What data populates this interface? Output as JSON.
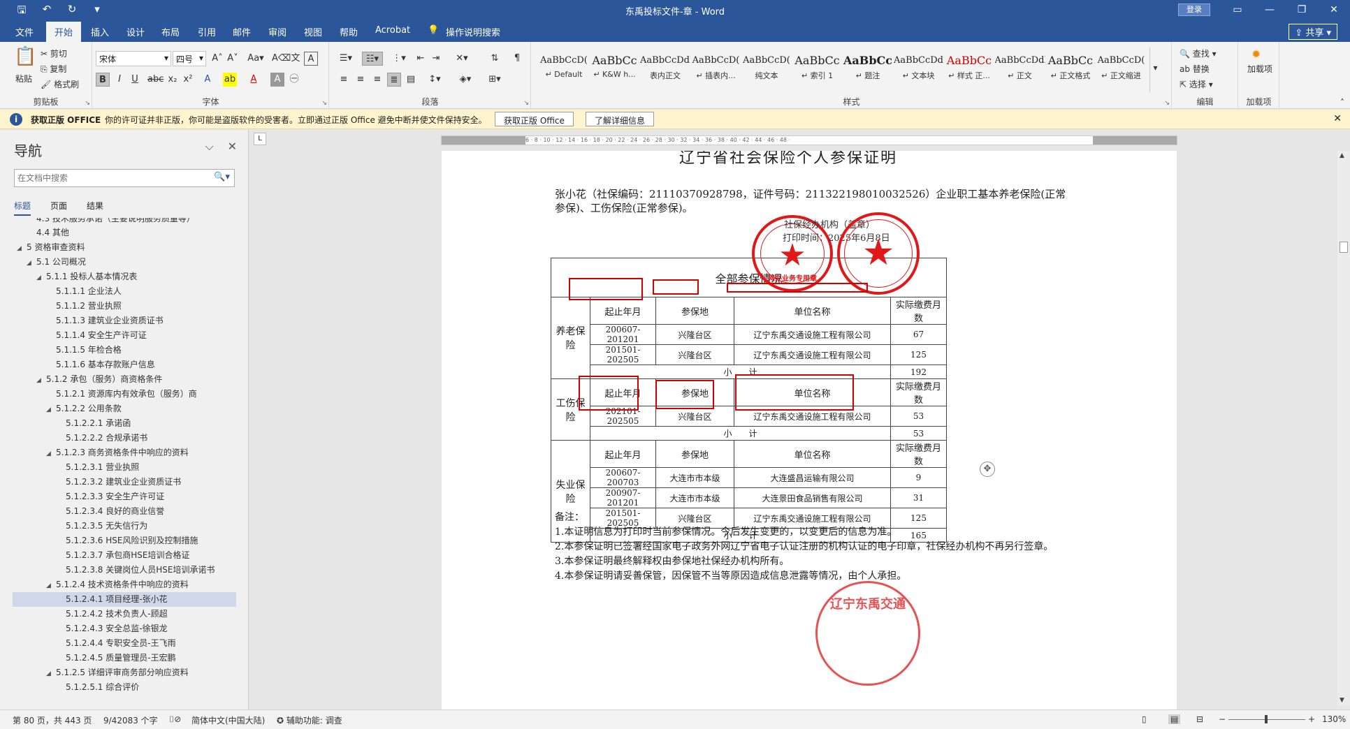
{
  "window": {
    "title": "东禹投标文件-章 - Word",
    "login_label": "登录",
    "share_label": "共享"
  },
  "tabs": [
    "文件",
    "开始",
    "插入",
    "设计",
    "布局",
    "引用",
    "邮件",
    "审阅",
    "视图",
    "帮助",
    "Acrobat",
    "操作说明搜索"
  ],
  "active_tab": "开始",
  "ribbon": {
    "clipboard": {
      "label": "剪贴板",
      "paste": "粘贴",
      "cut": "剪切",
      "copy": "复制",
      "format_painter": "格式刷"
    },
    "font": {
      "label": "字体",
      "font_name": "宋体",
      "font_size": "四号"
    },
    "paragraph": {
      "label": "段落"
    },
    "styles": {
      "label": "样式",
      "items": [
        {
          "sample": "AaBbCcD(",
          "name": "↵ Default"
        },
        {
          "sample": "AaBbCc",
          "name": "↵ K&W h..."
        },
        {
          "sample": "AaBbCcDdI",
          "name": "表内正文"
        },
        {
          "sample": "AaBbCcD(",
          "name": "↵ 插表内..."
        },
        {
          "sample": "AaBbCcD(",
          "name": "纯文本"
        },
        {
          "sample": "AaBbCc",
          "name": "↵ 索引 1"
        },
        {
          "sample": "AaBbCc",
          "name": "↵ 题注"
        },
        {
          "sample": "AaBbCcDd",
          "name": "↵ 文本块"
        },
        {
          "sample": "AaBbCc",
          "name": "↵ 样式 正..."
        },
        {
          "sample": "AaBbCcDdI",
          "name": "↵ 正文"
        },
        {
          "sample": "AaBbCc",
          "name": "↵ 正文格式"
        },
        {
          "sample": "AaBbCcD(",
          "name": "↵ 正文缩进"
        }
      ]
    },
    "editing": {
      "label": "编辑",
      "find": "查找",
      "replace": "替换",
      "select": "选择"
    },
    "addins": {
      "label": "加载项",
      "button": "加载项"
    }
  },
  "message_bar": {
    "title": "获取正版 OFFICE",
    "text": "你的许可证并非正版，你可能是盗版软件的受害者。立即通过正版 Office 避免中断并使文件保持安全。",
    "button1": "获取正版 Office",
    "button2": "了解详细信息"
  },
  "nav": {
    "title": "导航",
    "search_placeholder": "在文档中搜索",
    "tabs": [
      "标题",
      "页面",
      "结果"
    ],
    "items": [
      {
        "text": "4.3 技术服务承诺（主要说明服务质量等）",
        "level": 2,
        "tri": ""
      },
      {
        "text": "4.4 其他",
        "level": 2,
        "tri": ""
      },
      {
        "text": "5 资格审查资料",
        "level": 1,
        "tri": "◢"
      },
      {
        "text": "5.1 公司概况",
        "level": 2,
        "tri": "◢"
      },
      {
        "text": "5.1.1 投标人基本情况表",
        "level": 3,
        "tri": "◢"
      },
      {
        "text": "5.1.1.1 企业法人",
        "level": 4,
        "tri": ""
      },
      {
        "text": "5.1.1.2 营业执照",
        "level": 4,
        "tri": ""
      },
      {
        "text": "5.1.1.3 建筑业企业资质证书",
        "level": 4,
        "tri": ""
      },
      {
        "text": "5.1.1.4 安全生产许可证",
        "level": 4,
        "tri": ""
      },
      {
        "text": "5.1.1.5 年检合格",
        "level": 4,
        "tri": ""
      },
      {
        "text": "5.1.1.6 基本存款账户信息",
        "level": 4,
        "tri": ""
      },
      {
        "text": "5.1.2 承包（服务）商资格条件",
        "level": 3,
        "tri": "◢"
      },
      {
        "text": "5.1.2.1 资源库内有效承包（服务）商",
        "level": 4,
        "tri": ""
      },
      {
        "text": "5.1.2.2 公用条款",
        "level": 4,
        "tri": "◢"
      },
      {
        "text": "5.1.2.2.1 承诺函",
        "level": 5,
        "tri": ""
      },
      {
        "text": "5.1.2.2.2 合规承诺书",
        "level": 5,
        "tri": ""
      },
      {
        "text": "5.1.2.3 商务资格条件中响应的资料",
        "level": 4,
        "tri": "◢"
      },
      {
        "text": "5.1.2.3.1 营业执照",
        "level": 5,
        "tri": ""
      },
      {
        "text": "5.1.2.3.2 建筑业企业资质证书",
        "level": 5,
        "tri": ""
      },
      {
        "text": "5.1.2.3.3 安全生产许可证",
        "level": 5,
        "tri": ""
      },
      {
        "text": "5.1.2.3.4 良好的商业信誉",
        "level": 5,
        "tri": ""
      },
      {
        "text": "5.1.2.3.5 无失信行为",
        "level": 5,
        "tri": ""
      },
      {
        "text": "5.1.2.3.6 HSE风险识别及控制措施",
        "level": 5,
        "tri": ""
      },
      {
        "text": "5.1.2.3.7 承包商HSE培训合格证",
        "level": 5,
        "tri": ""
      },
      {
        "text": "5.1.2.3.8 关键岗位人员HSE培训承诺书",
        "level": 5,
        "tri": ""
      },
      {
        "text": "5.1.2.4 技术资格条件中响应的资料",
        "level": 4,
        "tri": "◢"
      },
      {
        "text": "5.1.2.4.1 项目经理-张小花",
        "level": 5,
        "tri": "",
        "selected": true
      },
      {
        "text": "5.1.2.4.2 技术负责人-顾超",
        "level": 5,
        "tri": ""
      },
      {
        "text": "5.1.2.4.3 安全总监-徐银龙",
        "level": 5,
        "tri": ""
      },
      {
        "text": "5.1.2.4.4 专职安全员-王飞雨",
        "level": 5,
        "tri": ""
      },
      {
        "text": "5.1.2.4.5 质量管理员-王宏鹏",
        "level": 5,
        "tri": ""
      },
      {
        "text": "5.1.2.5 详细评审商务部分响应资料",
        "level": 4,
        "tri": "◢"
      },
      {
        "text": "5.1.2.5.1 综合评价",
        "level": 5,
        "tri": ""
      }
    ]
  },
  "document": {
    "title": "辽宁省社会保险个人参保证明",
    "intro": "张小花（社保编码：21110370928798，证件号码：211322198010032526）企业职工基本养老保险(正常参保)、工伤保险(正常参保)。",
    "stamp_line1": "社保经办机构（盖章）",
    "stamp_line2": "打印时间：2025年6月8日",
    "table_title": "全部参保情况",
    "headers": [
      "起止年月",
      "参保地",
      "单位名称",
      "实际缴费月数"
    ],
    "subtotal_label": "小　　计",
    "sections": [
      {
        "name": "养老保险",
        "rows": [
          [
            "200607-201201",
            "兴隆台区",
            "辽宁东禹交通设施工程有限公司",
            "67"
          ],
          [
            "201501-202505",
            "兴隆台区",
            "辽宁东禹交通设施工程有限公司",
            "125"
          ]
        ],
        "subtotal": "192"
      },
      {
        "name": "工伤保险",
        "rows": [
          [
            "202101-202505",
            "兴隆台区",
            "辽宁东禹交通设施工程有限公司",
            "53"
          ]
        ],
        "subtotal": "53"
      },
      {
        "name": "失业保险",
        "rows": [
          [
            "200607-200703",
            "大连市市本级",
            "大连盛昌运输有限公司",
            "9"
          ],
          [
            "200907-201201",
            "大连市市本级",
            "大连景田食品销售有限公司",
            "31"
          ],
          [
            "201501-202505",
            "兴隆台区",
            "辽宁东禹交通设施工程有限公司",
            "125"
          ]
        ],
        "subtotal": "165"
      }
    ],
    "notes_title": "备注：",
    "notes": [
      "1.本证明信息为打印时当前参保情况。今后发生变更的，以变更后的信息为准。",
      "2.本参保证明已签署经国家电子政务外网辽宁省电子认证注册的机构认证的电子印章，社保经办机构不再另行签章。",
      "3.本参保证明最终解释权由参保地社保经办机构所有。",
      "4.本参保证明请妥善保管，因保管不当等原因造成信息泄露等情况，由个人承担。"
    ],
    "seal1_bottom": "网办业务专用章",
    "seal3_text": "辽宁东禹交通"
  },
  "statusbar": {
    "page": "第 80 页，共 443 页",
    "words": "9/42083 个字",
    "language": "简体中文(中国大陆)",
    "accessibility": "辅助功能: 调查",
    "zoom": "130%"
  },
  "colors": {
    "accent": "#2b579a",
    "seal_red": "#e01818",
    "annotation_red": "#d40000",
    "message_bar": "#fff4ce"
  }
}
